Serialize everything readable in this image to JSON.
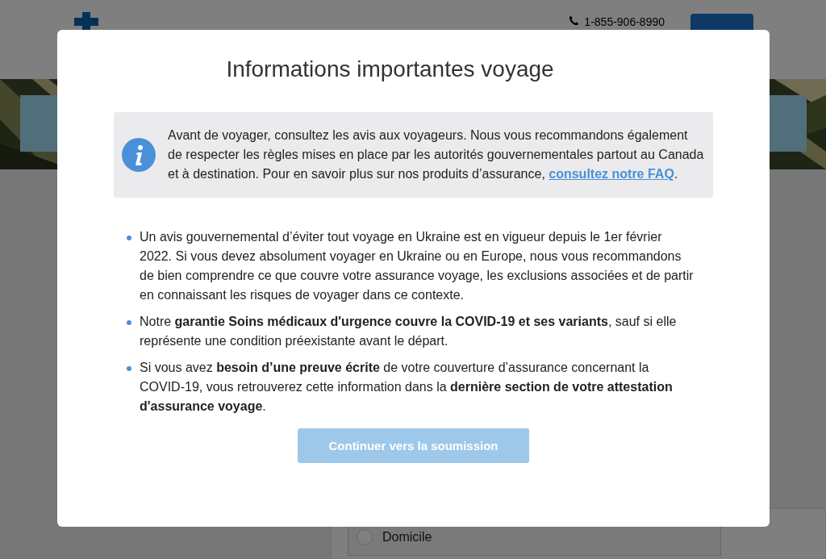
{
  "header": {
    "phone": "1-855-906-8990"
  },
  "background_option": {
    "label": "Domicile",
    "selected": false
  },
  "modal": {
    "title": "Informations importantes voyage",
    "notice": {
      "text": "Avant de voyager, consultez les avis aux voyageurs. Nous vous recommandons également de respecter les règles mises en place par les autorités gouvernementales partout au Canada et à destination. Pour en savoir plus sur nos produits d’assurance, ",
      "link": "consultez notre FAQ",
      "after": "."
    },
    "bullets": [
      "Un avis gouvernemental d’éviter tout voyage en Ukraine est en vigueur depuis le 1er février 2022. Si vous devez absolument voyager en Ukraine ou en Europe, nous vous recommandons de bien comprendre ce que couvre votre assurance voyage, les exclusions associées et de partir en connaissant les risques de voyager dans ce contexte.",
      "Notre **garantie Soins médicaux d'urgence couvre la COVID-19 et ses variants**, sauf si elle représente une condition préexistante avant le départ.",
      "Si vous avez **besoin d’une preuve écrite** de votre couverture d’assurance concernant la COVID-19, vous retrouverez cette information dans la **dernière section de votre attestation d'assurance voyage**."
    ],
    "button": "Continuer vers la soumission"
  }
}
